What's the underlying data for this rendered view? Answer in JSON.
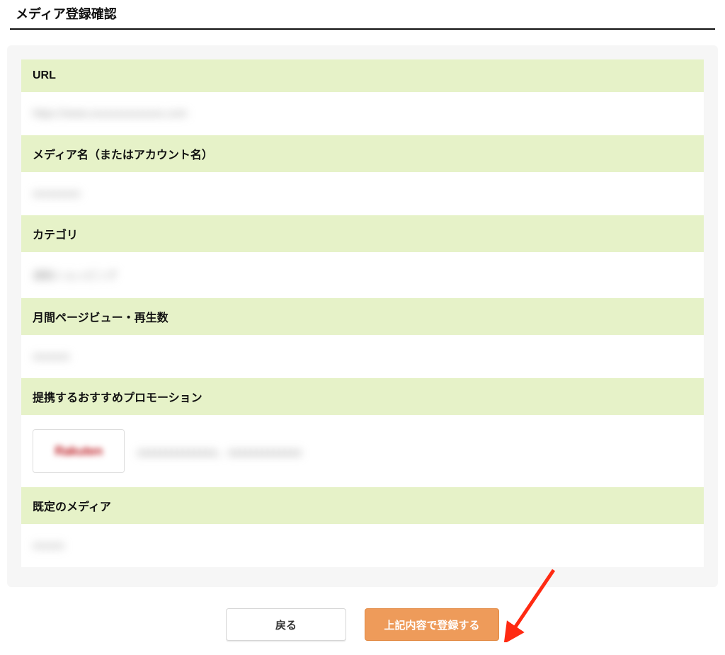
{
  "page_title": "メディア登録確認",
  "sections": {
    "url": {
      "label": "URL",
      "value": "https://www.xxxxxxxxxxxxxx.com"
    },
    "media_name": {
      "label": "メディア名（またはアカウント名）",
      "value": "xxxxxxxxx"
    },
    "category": {
      "label": "カテゴリ",
      "value": "通販ショッピング"
    },
    "pv": {
      "label": "月間ページビュー・再生数",
      "value": "xxxxxxx"
    },
    "promotion": {
      "label": "提携するおすすめプロモーション",
      "thumb_text": "Rakuten",
      "value": "xxxxxxxxxxxxxx、xxxxxxxxxxxxx"
    },
    "default_media": {
      "label": "既定のメディア",
      "value": "xxxxxx"
    }
  },
  "buttons": {
    "back": "戻る",
    "submit": "上記内容で登録する"
  }
}
